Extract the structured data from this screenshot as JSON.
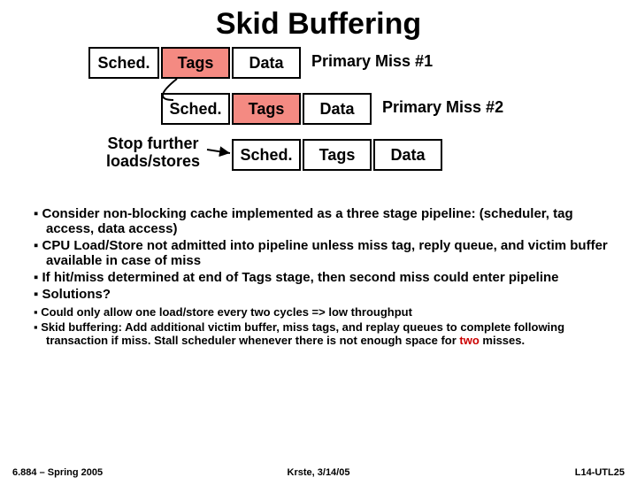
{
  "title": "Skid Buffering",
  "stages": {
    "sched": "Sched.",
    "tags": "Tags",
    "data": "Data"
  },
  "labels": {
    "miss1": "Primary Miss #1",
    "miss2": "Primary Miss #2",
    "stop1": "Stop further",
    "stop2": "loads/stores"
  },
  "bullets": [
    "Consider non-blocking cache implemented as a three stage pipeline: (scheduler, tag access, data access)",
    "CPU Load/Store not admitted into pipeline unless miss tag, reply queue, and victim buffer available in case of miss",
    "If hit/miss determined at end of Tags stage, then second miss could enter pipeline",
    "Solutions?"
  ],
  "sub": [
    "Could only allow one load/store every two cycles => low throughput",
    "Skid buffering: Add additional victim buffer, miss tags, and replay queues to complete following transaction if miss.  Stall scheduler whenever there is not enough space for "
  ],
  "sub_tail": {
    "two": "two",
    "after": " misses."
  },
  "footer": {
    "left": "6.884 – Spring 2005",
    "mid": "Krste, 3/14/05",
    "right": "L14-UTL25"
  }
}
